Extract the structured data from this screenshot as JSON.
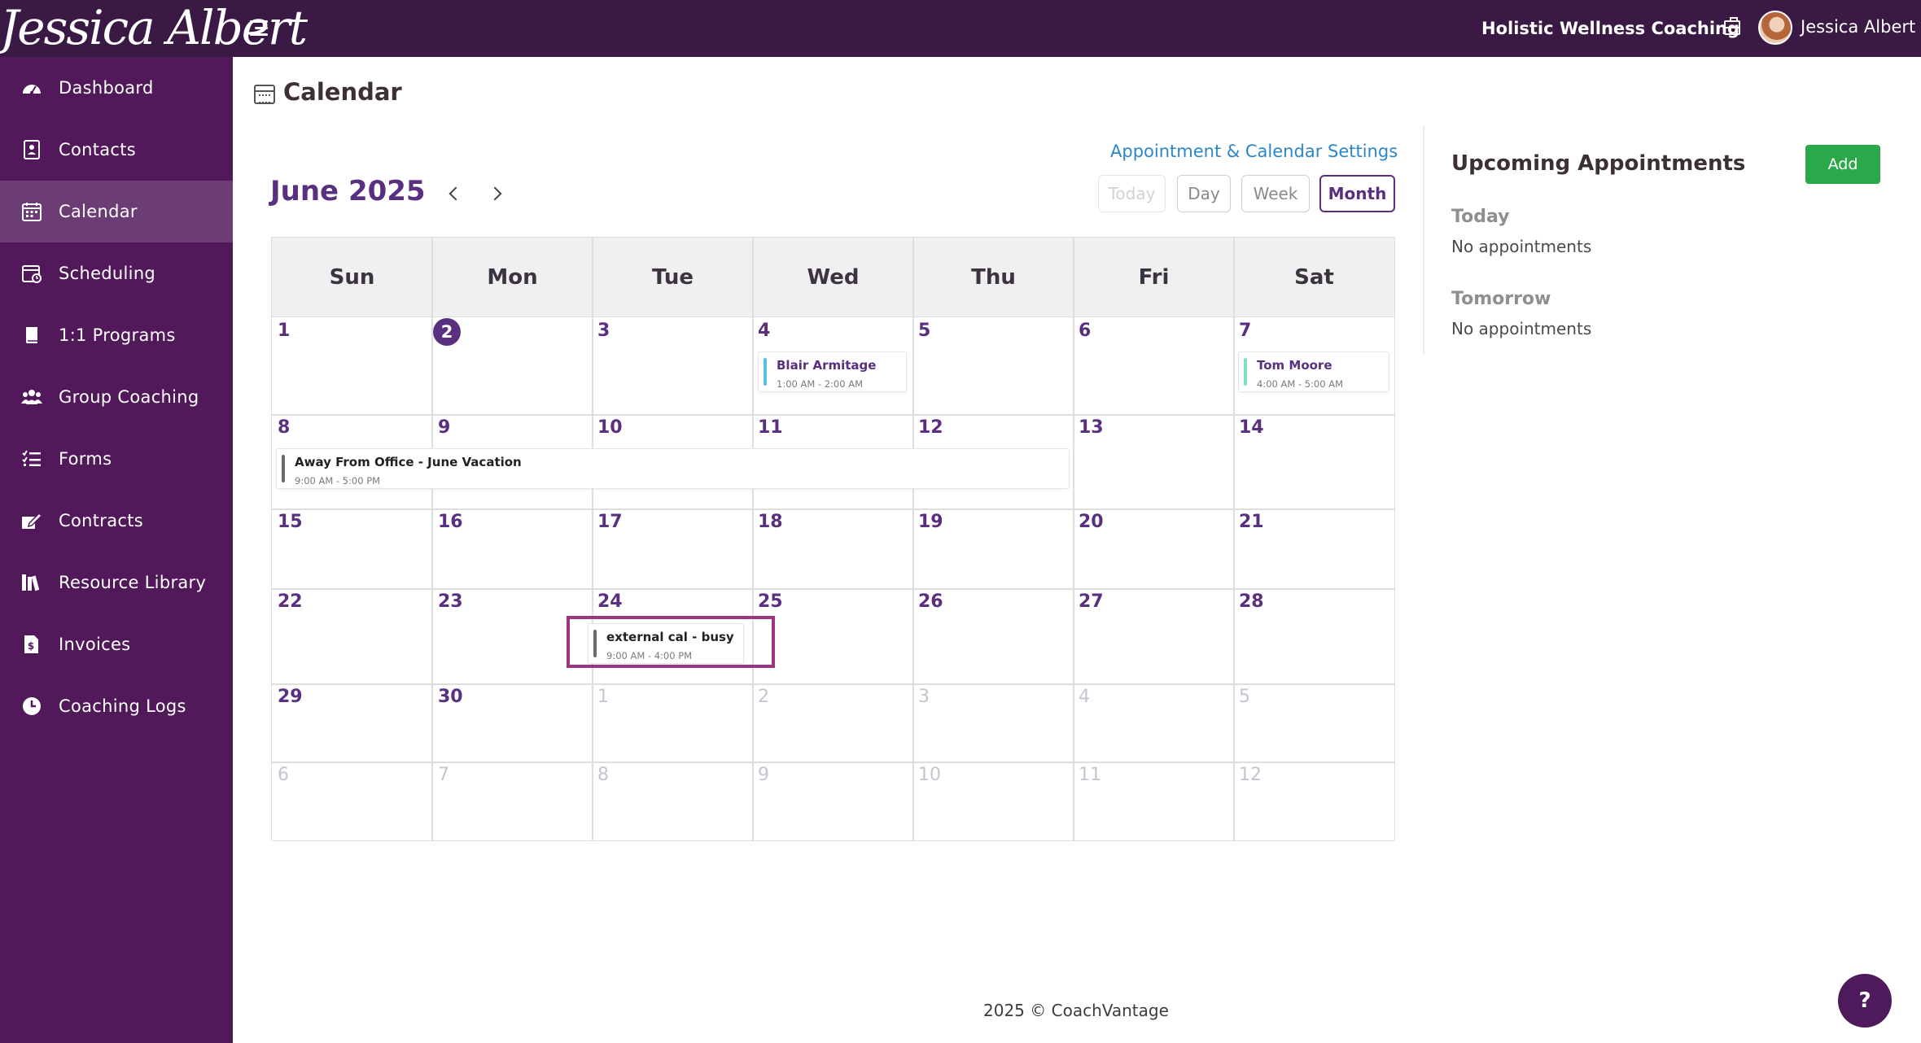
{
  "header": {
    "logo_text": "Jessica Albert",
    "business_name": "Holistic Wellness Coaching",
    "user_name": "Jessica Albert"
  },
  "sidebar": {
    "items": [
      {
        "label": "Dashboard",
        "icon": "dashboard-icon"
      },
      {
        "label": "Contacts",
        "icon": "contacts-icon"
      },
      {
        "label": "Calendar",
        "icon": "calendar-icon",
        "active": true
      },
      {
        "label": "Scheduling",
        "icon": "scheduling-icon"
      },
      {
        "label": "1:1 Programs",
        "icon": "book-icon"
      },
      {
        "label": "Group Coaching",
        "icon": "group-icon"
      },
      {
        "label": "Forms",
        "icon": "list-icon"
      },
      {
        "label": "Contracts",
        "icon": "signature-icon"
      },
      {
        "label": "Resource Library",
        "icon": "library-icon"
      },
      {
        "label": "Invoices",
        "icon": "invoice-icon"
      },
      {
        "label": "Coaching Logs",
        "icon": "clock-icon"
      }
    ]
  },
  "main": {
    "page_title": "Calendar",
    "settings_link": "Appointment & Calendar Settings",
    "month_title": "June 2025",
    "view_buttons": {
      "today": "Today",
      "day": "Day",
      "week": "Week",
      "month": "Month"
    },
    "active_view": "Month"
  },
  "calendar": {
    "weekdays": [
      "Sun",
      "Mon",
      "Tue",
      "Wed",
      "Thu",
      "Fri",
      "Sat"
    ],
    "weeks": [
      [
        "1",
        "2",
        "3",
        "4",
        "5",
        "6",
        "7"
      ],
      [
        "8",
        "9",
        "10",
        "11",
        "12",
        "13",
        "14"
      ],
      [
        "15",
        "16",
        "17",
        "18",
        "19",
        "20",
        "21"
      ],
      [
        "22",
        "23",
        "24",
        "25",
        "26",
        "27",
        "28"
      ],
      [
        "29",
        "30",
        "1",
        "2",
        "3",
        "4",
        "5"
      ],
      [
        "6",
        "7",
        "8",
        "9",
        "10",
        "11",
        "12"
      ]
    ],
    "events": [
      {
        "title": "Blair Armitage",
        "time": "1:00 AM - 2:00 AM",
        "color": "#5bc0de",
        "title_color": "#5a2f80"
      },
      {
        "title": "Tom Moore",
        "time": "4:00 AM - 5:00 AM",
        "color": "#7fe0c4",
        "title_color": "#5a2f80"
      },
      {
        "title": "Away From Office - June Vacation",
        "time": "9:00 AM - 5:00 PM",
        "color": "#6b6b6b",
        "title_color": "#222222"
      },
      {
        "title": "external cal - busy",
        "time": "9:00 AM - 4:00 PM",
        "color": "#6b6b6b",
        "title_color": "#222222"
      }
    ]
  },
  "upcoming": {
    "title": "Upcoming Appointments",
    "add_label": "Add",
    "groups": [
      {
        "day": "Today",
        "text": "No appointments"
      },
      {
        "day": "Tomorrow",
        "text": "No appointments"
      }
    ]
  },
  "footer": {
    "text": "2025 © CoachVantage"
  },
  "help": {
    "label": "?"
  },
  "colors": {
    "accent": "#5a2f80",
    "topbar": "#3a1945",
    "sidebar": "#51195a",
    "add_button": "#2aa84a",
    "highlight": "#9c3480"
  }
}
